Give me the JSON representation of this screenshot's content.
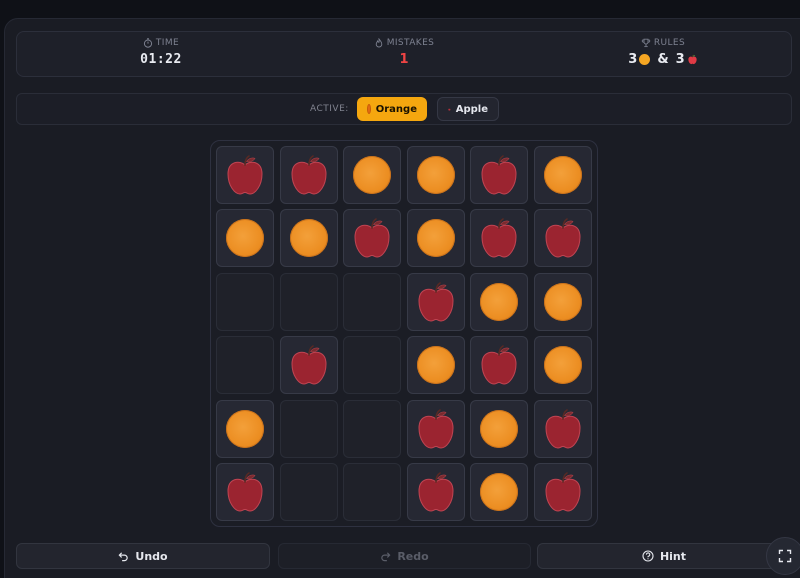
{
  "stats": {
    "time_label": "TIME",
    "time_value": "01:22",
    "mistakes_label": "MISTAKES",
    "mistakes_value": "1",
    "rules_label": "RULES",
    "rules_orange_count": "3",
    "rules_amp": "&",
    "rules_apple_count": "3"
  },
  "active": {
    "label": "ACTIVE:",
    "options": [
      {
        "label": "Orange",
        "selected": true
      },
      {
        "label": "Apple",
        "selected": false
      }
    ]
  },
  "board": {
    "rows": 6,
    "cols": 6,
    "cells": [
      [
        "apple",
        "apple",
        "orange",
        "orange",
        "apple",
        "orange"
      ],
      [
        "orange",
        "orange",
        "apple",
        "orange",
        "apple",
        "apple"
      ],
      [
        "",
        "",
        "",
        "apple",
        "orange",
        "orange"
      ],
      [
        "",
        "apple",
        "",
        "orange",
        "apple",
        "orange"
      ],
      [
        "orange",
        "",
        "",
        "apple",
        "orange",
        "apple"
      ],
      [
        "apple",
        "",
        "",
        "apple",
        "orange",
        "apple"
      ]
    ],
    "prefilled": [
      [
        true,
        true,
        true,
        true,
        true,
        true
      ],
      [
        true,
        true,
        false,
        false,
        false,
        true
      ],
      [
        false,
        false,
        false,
        true,
        false,
        false
      ],
      [
        false,
        true,
        false,
        false,
        false,
        false
      ],
      [
        false,
        false,
        false,
        true,
        false,
        false
      ],
      [
        true,
        false,
        false,
        true,
        false,
        true
      ]
    ]
  },
  "controls": {
    "undo_label": "Undo",
    "redo_label": "Redo",
    "hint_label": "Hint"
  },
  "colors": {
    "orange": "#ec8e22",
    "apple": "#9b2430",
    "accent": "#f5a70f",
    "mistake": "#ef4444"
  },
  "icons": {
    "time": "stopwatch-icon",
    "mistakes": "flame-icon",
    "rules": "trophy-icon",
    "undo": "undo-arrow-icon",
    "redo": "redo-arrow-icon",
    "hint": "question-circle-icon",
    "fullscreen": "fullscreen-icon"
  }
}
